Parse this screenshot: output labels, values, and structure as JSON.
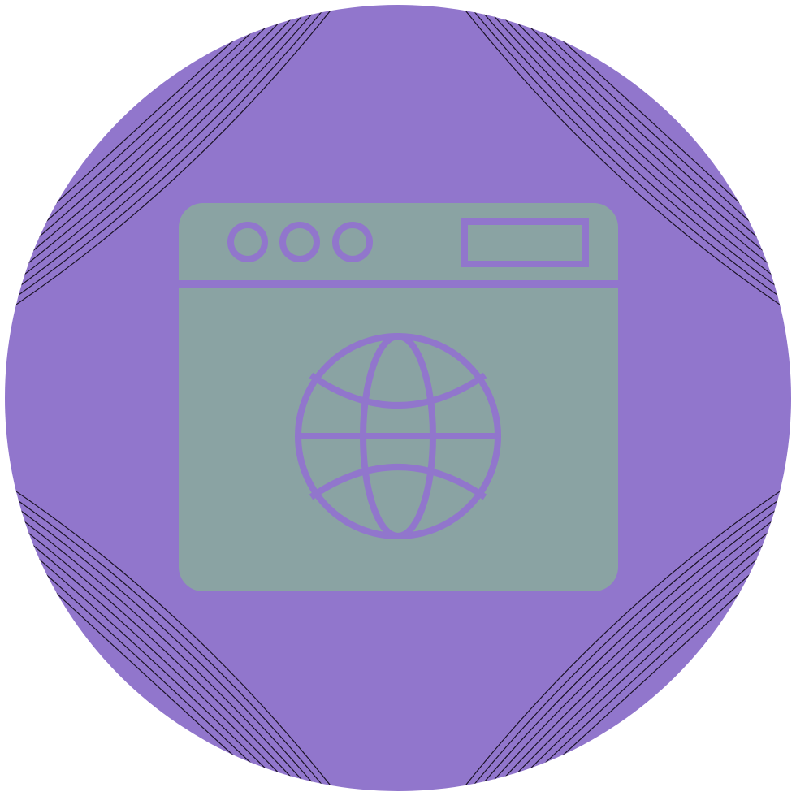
{
  "icon": {
    "name": "web-browser-globe-icon",
    "colors": {
      "background": "#ffffff",
      "circle_fill": "#9176cc",
      "window_fill": "#8aa3a3",
      "line_accent": "#9176cc",
      "hatch_stroke": "#1a1226"
    }
  }
}
